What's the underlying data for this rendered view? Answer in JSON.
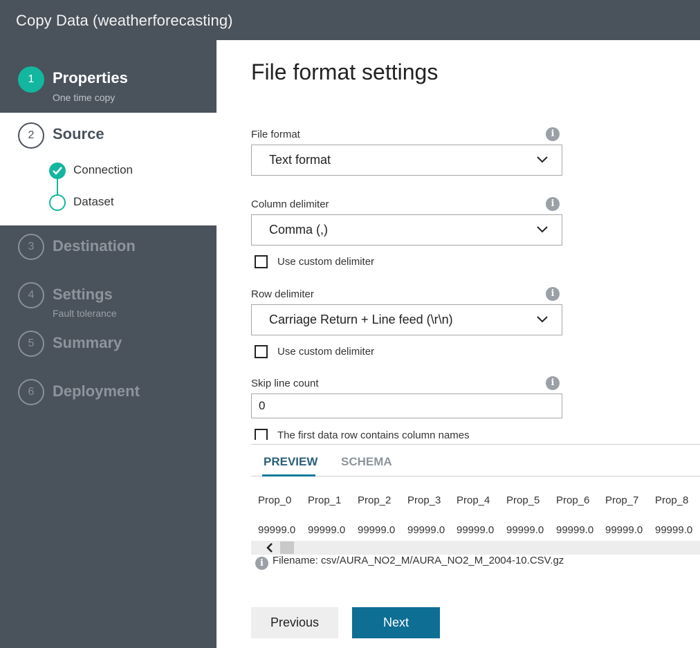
{
  "window": {
    "title": "Copy Data (weatherforecasting)"
  },
  "sidebar": {
    "steps": [
      {
        "number": "1",
        "label": "Properties",
        "sub": "One time copy"
      },
      {
        "number": "2",
        "label": "Source",
        "sub": ""
      },
      {
        "number": "3",
        "label": "Destination",
        "sub": ""
      },
      {
        "number": "4",
        "label": "Settings",
        "sub": "Fault tolerance"
      },
      {
        "number": "5",
        "label": "Summary",
        "sub": ""
      },
      {
        "number": "6",
        "label": "Deployment",
        "sub": ""
      }
    ],
    "source_substeps": [
      {
        "label": "Connection",
        "state": "complete"
      },
      {
        "label": "Dataset",
        "state": "current"
      }
    ]
  },
  "main": {
    "heading": "File format settings",
    "file_format": {
      "label": "File format",
      "value": "Text format"
    },
    "column_delimiter": {
      "label": "Column delimiter",
      "value": "Comma (,)",
      "custom_label": "Use custom delimiter",
      "custom_checked": false
    },
    "row_delimiter": {
      "label": "Row delimiter",
      "value": "Carriage Return + Line feed (\\r\\n)",
      "custom_label": "Use custom delimiter",
      "custom_checked": false
    },
    "skip_line_count": {
      "label": "Skip line count",
      "value": "0"
    },
    "first_row_header": {
      "label": "The first data row contains column names",
      "checked": false
    },
    "tabs": [
      {
        "label": "PREVIEW",
        "active": true
      },
      {
        "label": "SCHEMA",
        "active": false
      }
    ],
    "preview": {
      "columns": [
        "Prop_0",
        "Prop_1",
        "Prop_2",
        "Prop_3",
        "Prop_4",
        "Prop_5",
        "Prop_6",
        "Prop_7",
        "Prop_8"
      ],
      "rows": [
        [
          "99999.0",
          "99999.0",
          "99999.0",
          "99999.0",
          "99999.0",
          "99999.0",
          "99999.0",
          "99999.0",
          "99999.0"
        ]
      ]
    },
    "filename": "Filename: csv/AURA_NO2_M/AURA_NO2_M_2004-10.CSV.gz",
    "buttons": {
      "previous": "Previous",
      "next": "Next"
    }
  },
  "colors": {
    "accent": "#13b69e",
    "sidebar": "#4a525c",
    "primary_button": "#0e6e94"
  },
  "icons": [
    "check-icon",
    "info-icon",
    "chevron-down-icon",
    "chevron-left-icon"
  ]
}
